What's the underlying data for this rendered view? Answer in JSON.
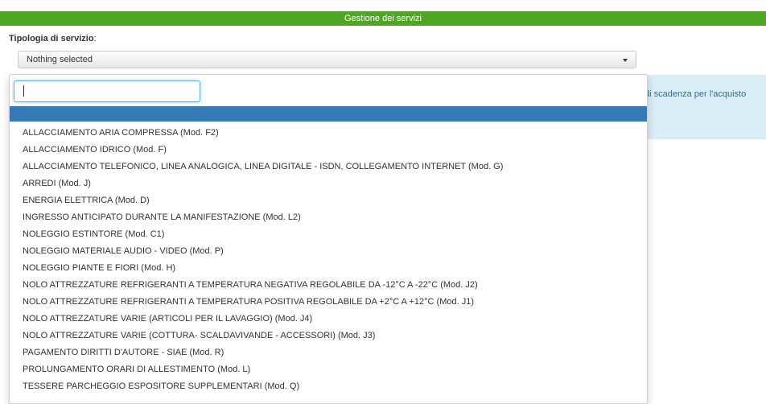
{
  "header": {
    "title": "Gestione dei servizi"
  },
  "field": {
    "label": "Tipologia di servizio",
    "label_suffix": ":"
  },
  "select": {
    "selected_text": "Nothing selected"
  },
  "search": {
    "value": "",
    "placeholder": ""
  },
  "info_panel": {
    "text": "di scadenza per l'acquisto"
  },
  "options": [
    "ALLACCIAMENTO ARIA COMPRESSA (Mod. F2)",
    "ALLACCIAMENTO IDRICO (Mod. F)",
    "ALLACCIAMENTO TELEFONICO, LINEA ANALOGICA, LINEA DIGITALE - ISDN, COLLEGAMENTO INTERNET (Mod. G)",
    "ARREDI (Mod. J)",
    "ENERGIA ELETTRICA (Mod. D)",
    "INGRESSO ANTICIPATO DURANTE LA MANIFESTAZIONE (Mod. L2)",
    "NOLEGGIO ESTINTORE (Mod. C1)",
    "NOLEGGIO MATERIALE AUDIO - VIDEO (Mod. P)",
    "NOLEGGIO PIANTE E FIORI (Mod. H)",
    "NOLO ATTREZZATURE REFRIGERANTI A TEMPERATURA NEGATIVA REGOLABILE DA -12°C A -22°C (Mod. J2)",
    "NOLO ATTREZZATURE REFRIGERANTI A TEMPERATURA POSITIVA REGOLABILE DA +2°C A +12°C (Mod. J1)",
    "NOLO ATTREZZATURE VARIE (ARTICOLI PER IL LAVAGGIO) (Mod. J4)",
    "NOLO ATTREZZATURE VARIE (COTTURA- SCALDAVIVANDE - ACCESSORI) (Mod. J3)",
    "PAGAMENTO DIRITTI D'AUTORE - SIAE (Mod. R)",
    "PROLUNGAMENTO ORARI DI ALLESTIMENTO (Mod. L)",
    "TESSERE PARCHEGGIO ESPOSITORE SUPPLEMENTARI (Mod. Q)"
  ],
  "colors": {
    "header_bg": "#4ea622",
    "highlight": "#337ab7",
    "info_bg": "#d9edf7"
  }
}
